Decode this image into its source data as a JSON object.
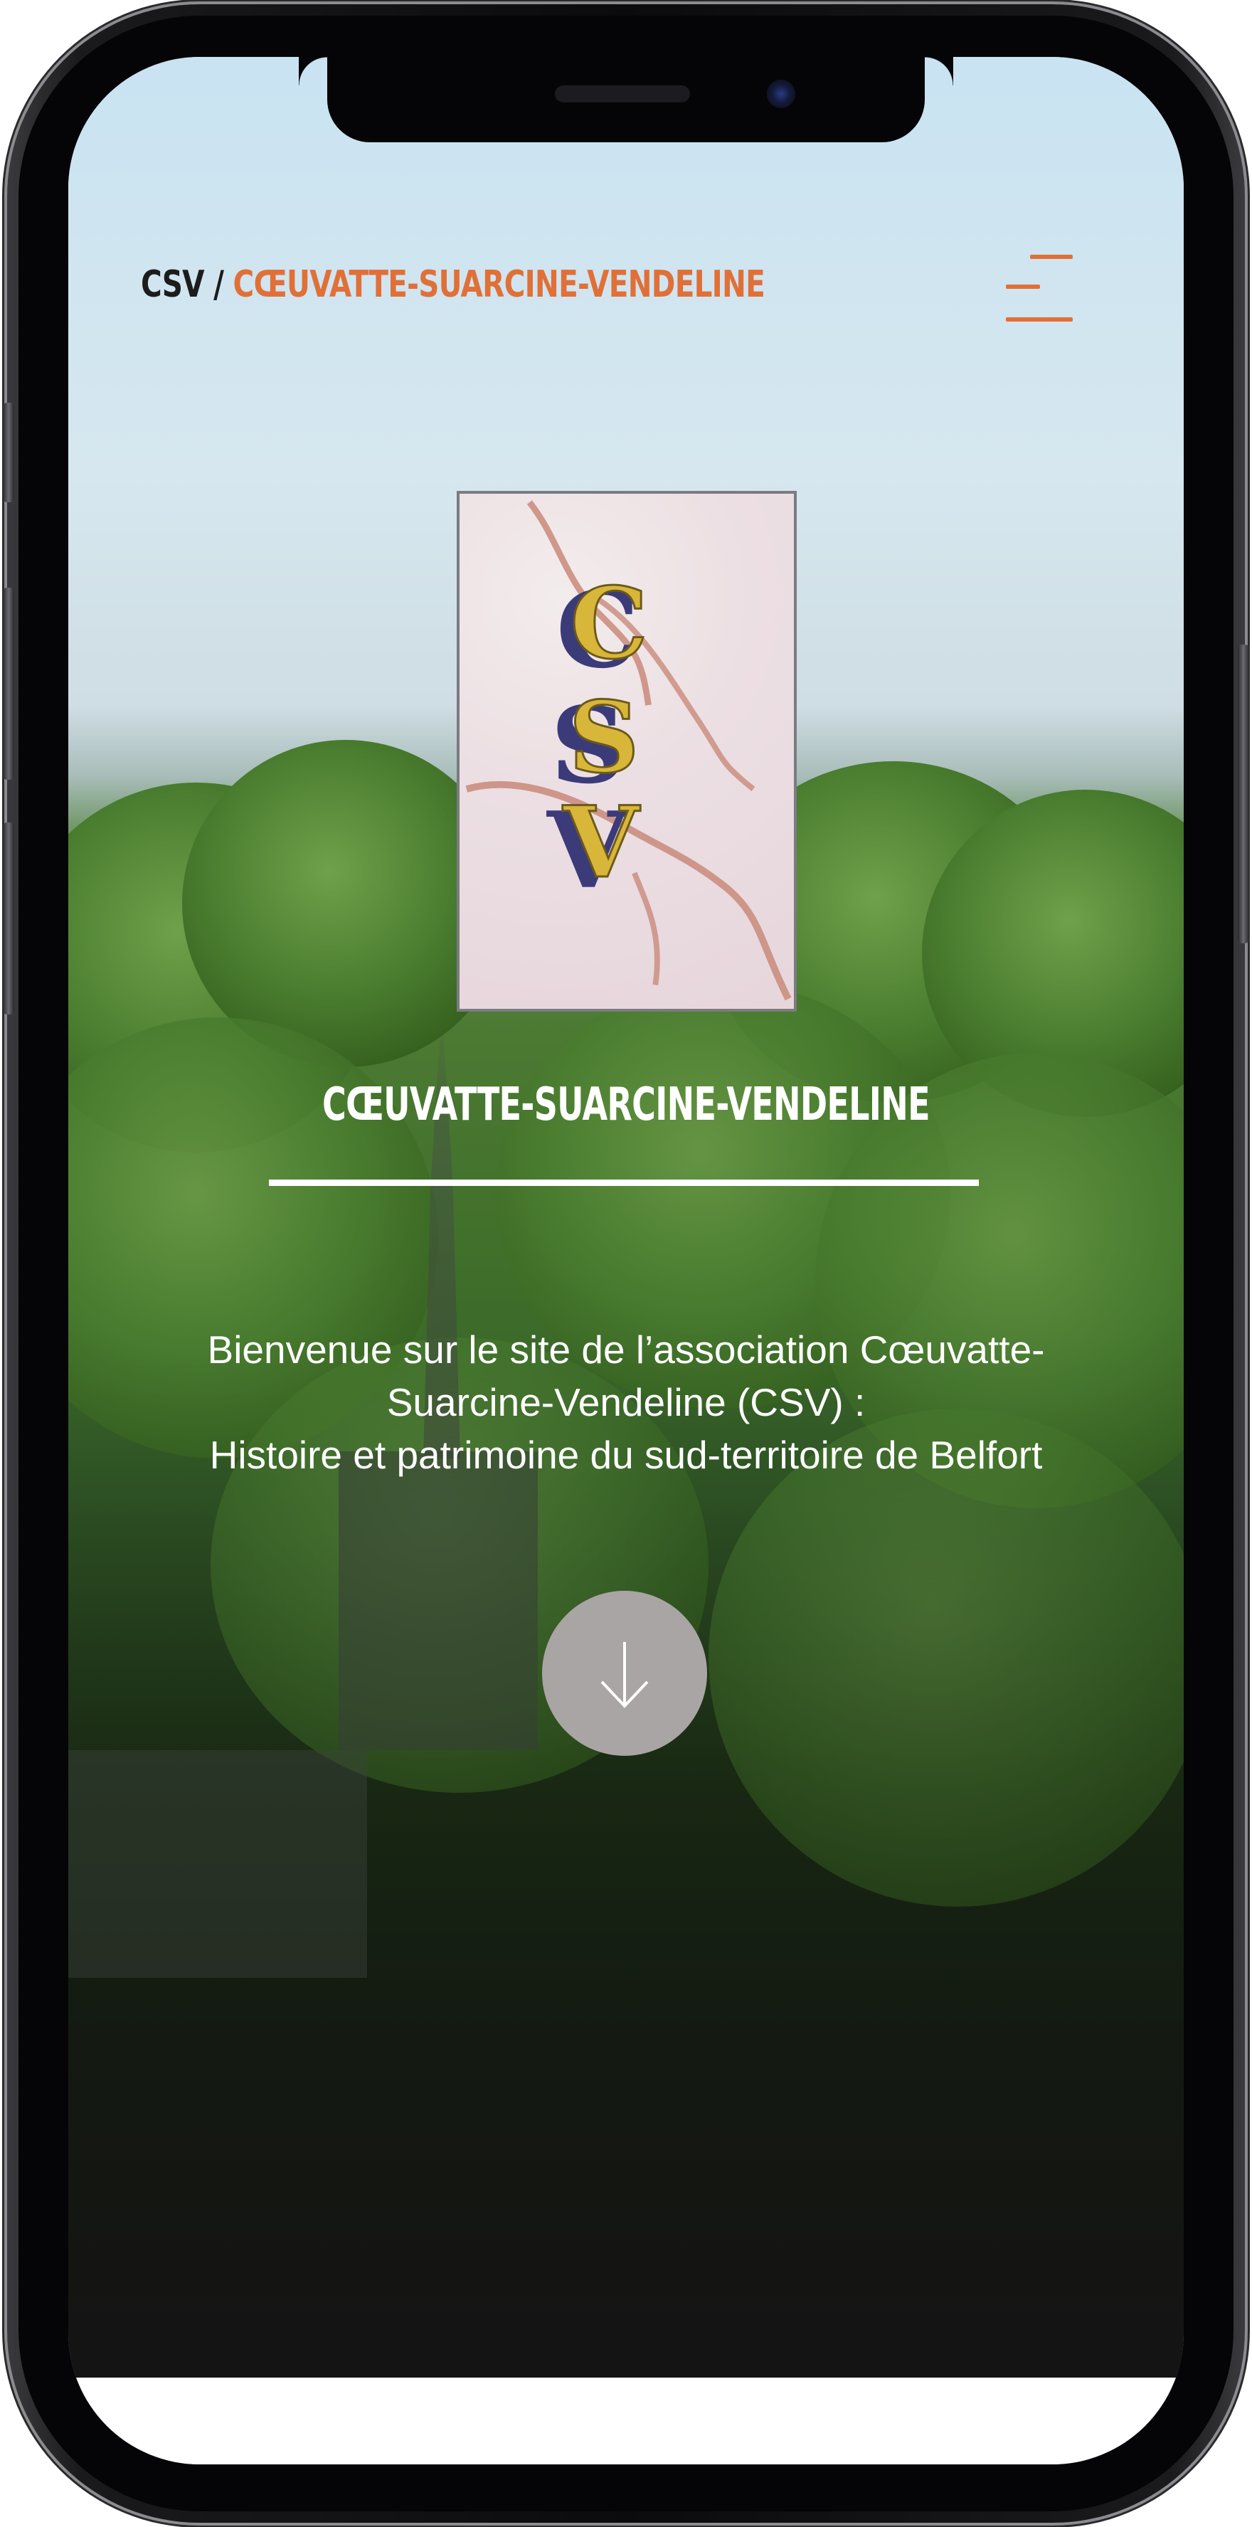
{
  "header": {
    "abbr": "CSV",
    "separator": " / ",
    "name": "CŒUVATTE-SUARCINE-VENDELINE",
    "menu_icon": "hamburger-menu-icon",
    "accent_color": "#e07038"
  },
  "logo": {
    "letters": [
      "C",
      "S",
      "V"
    ]
  },
  "hero": {
    "title": "CŒUVATTE-SUARCINE-VENDELINE",
    "welcome_lines": [
      "Bienvenue sur le site de l’association Cœuvatte-",
      "Suarcine-Vendeline (CSV) :",
      "Histoire et patrimoine du sud-territoire de Belfort"
    ],
    "scroll_icon": "arrow-down-icon"
  }
}
